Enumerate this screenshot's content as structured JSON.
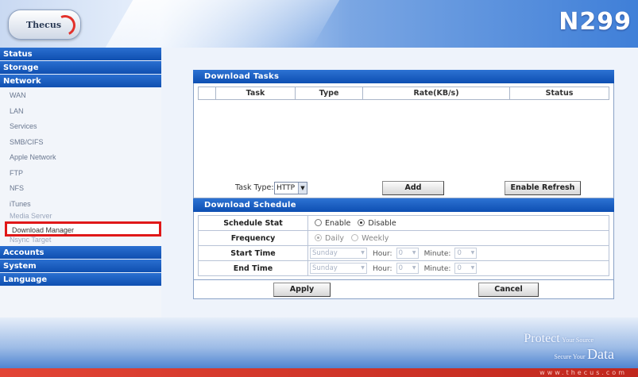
{
  "brand": {
    "logo_text": "Thecus",
    "model": "N299"
  },
  "sidebar": {
    "categories": {
      "status": "Status",
      "storage": "Storage",
      "network": "Network",
      "accounts": "Accounts",
      "system": "System",
      "language": "Language"
    },
    "network_items": [
      "WAN",
      "LAN",
      "Services",
      "SMB/CIFS",
      "Apple Network",
      "FTP",
      "NFS",
      "iTunes",
      "Media Server",
      "Download Manager",
      "Nsync Target"
    ],
    "selected_item": "Download Manager"
  },
  "tasks": {
    "title": "Download Tasks",
    "columns": [
      "",
      "Task",
      "Type",
      "Rate(KB/s)",
      "Status"
    ],
    "task_type_label": "Task Type:",
    "task_type_value": "HTTP",
    "add_label": "Add",
    "refresh_label": "Enable Refresh"
  },
  "schedule": {
    "title": "Download Schedule",
    "stat_label": "Schedule Stat",
    "enable_label": "Enable",
    "disable_label": "Disable",
    "stat_value": "Disable",
    "frequency_label": "Frequency",
    "daily_label": "Daily",
    "weekly_label": "Weekly",
    "frequency_value": "Daily",
    "start_label": "Start Time",
    "end_label": "End Time",
    "day_value": "Sunday",
    "hour_label": "Hour:",
    "minute_label": "Minute:",
    "hour_value": "0",
    "minute_value": "0",
    "apply_label": "Apply",
    "cancel_label": "Cancel"
  },
  "footer": {
    "slogan_protect": "Protect",
    "slogan_your_source": "Your Source",
    "slogan_secure_your": "Secure Your",
    "slogan_data": "Data",
    "url": "www.thecus.com"
  },
  "colors": {
    "accent": "#1257bf",
    "highlight": "#e01818",
    "footer_red": "#d8372a"
  }
}
